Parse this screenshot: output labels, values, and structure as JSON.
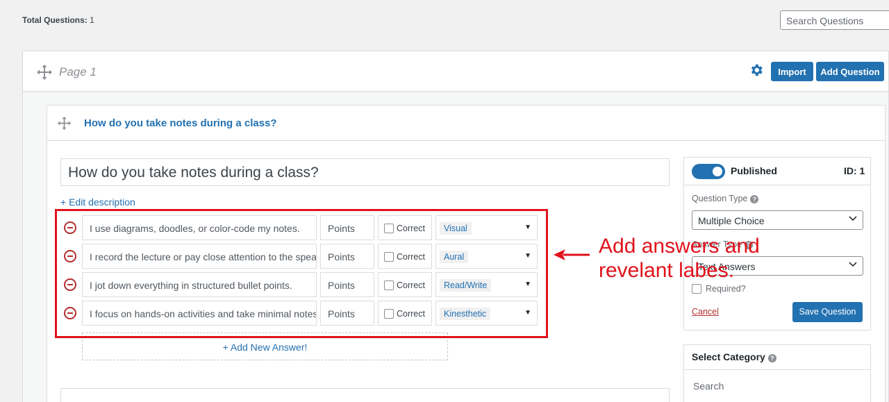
{
  "top": {
    "total_label": "Total Questions:",
    "total_value": "1",
    "search_placeholder": "Search Questions"
  },
  "page": {
    "title": "Page 1",
    "import_label": "Import",
    "add_question_label": "Add Question"
  },
  "question": {
    "header_title": "How do you take notes during a class?",
    "title_value": "How do you take notes during a class?",
    "edit_description": "+ Edit description",
    "answers": [
      {
        "text": "I use diagrams, doodles, or color-code my notes.",
        "points": "Points",
        "correct": "Correct",
        "label": "Visual"
      },
      {
        "text": "I record the lecture or pay close attention to the spea",
        "points": "Points",
        "correct": "Correct",
        "label": "Aural"
      },
      {
        "text": "I jot down everything in structured bullet points.",
        "points": "Points",
        "correct": "Correct",
        "label": "Read/Write"
      },
      {
        "text": "I focus on hands-on activities and take minimal notes",
        "points": "Points",
        "correct": "Correct",
        "label": "Kinesthetic"
      }
    ],
    "add_answer": "+ Add New Answer!"
  },
  "annotation": {
    "line1": "Add answers and",
    "line2": "revelant labes.",
    "color": "#e0121b"
  },
  "sidebar": {
    "published_label": "Published",
    "id_label": "ID: 1",
    "question_type_label": "Question Type",
    "question_type_value": "Multiple Choice",
    "answer_type_label": "Answer Type",
    "answer_type_value": "Text Answers",
    "required_label": "Required?",
    "cancel_label": "Cancel",
    "save_label": "Save Question"
  },
  "category": {
    "title": "Select Category",
    "search_placeholder": "Search"
  },
  "colors": {
    "accent": "#2271b1",
    "danger": "#b32d2e"
  }
}
